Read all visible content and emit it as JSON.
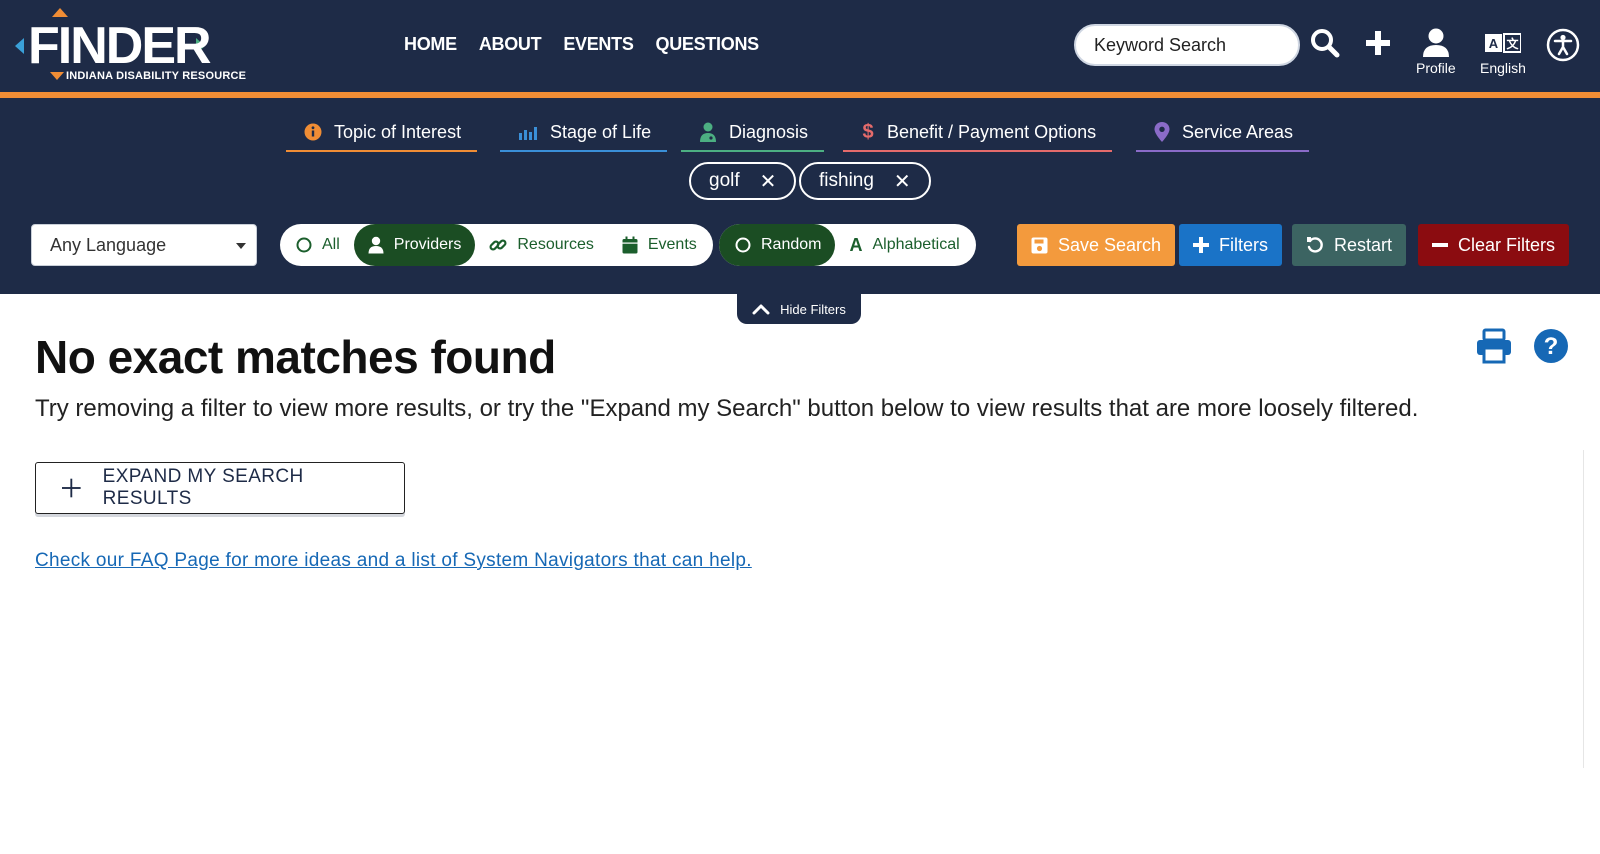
{
  "brand": {
    "name": "FINDER",
    "tagline": "INDIANA DISABILITY RESOURCE"
  },
  "nav": {
    "items": [
      "HOME",
      "ABOUT",
      "EVENTS",
      "QUESTIONS"
    ]
  },
  "search": {
    "placeholder": "Keyword Search"
  },
  "header_actions": {
    "profile_label": "Profile",
    "language_label": "English"
  },
  "categories": [
    {
      "label": "Topic of Interest",
      "icon": "info-circle-icon",
      "color": "#f08d35"
    },
    {
      "label": "Stage of Life",
      "icon": "bar-chart-icon",
      "color": "#3a8fd8"
    },
    {
      "label": "Diagnosis",
      "icon": "doctor-icon",
      "color": "#4caf82"
    },
    {
      "label": "Benefit / Payment Options",
      "icon": "dollar-icon",
      "color": "#e56b6b"
    },
    {
      "label": "Service Areas",
      "icon": "map-pin-icon",
      "color": "#8a6bc8"
    }
  ],
  "chips": [
    {
      "label": "golf"
    },
    {
      "label": "fishing"
    }
  ],
  "language_select": {
    "value": "Any Language"
  },
  "type_filter": {
    "items": [
      {
        "label": "All",
        "icon": "circle-icon",
        "active": false
      },
      {
        "label": "Providers",
        "icon": "user-icon",
        "active": true
      },
      {
        "label": "Resources",
        "icon": "link-icon",
        "active": false
      },
      {
        "label": "Events",
        "icon": "calendar-icon",
        "active": false
      }
    ]
  },
  "sort_filter": {
    "items": [
      {
        "label": "Random",
        "icon": "circle-icon",
        "active": true
      },
      {
        "label": "Alphabetical",
        "icon": "letter-a-icon",
        "active": false
      }
    ]
  },
  "actions": {
    "save_search": "Save Search",
    "filters": "Filters",
    "restart": "Restart",
    "clear_filters": "Clear Filters",
    "colors": {
      "save_search": "#f39a3d",
      "filters": "#1a73c7",
      "restart": "#3c6462",
      "clear_filters": "#8b0c10"
    }
  },
  "hide_filters": {
    "label": "Hide Filters"
  },
  "results": {
    "title": "No exact matches found",
    "description": "Try removing a filter to view more results, or try the \"Expand my Search\" button below to view results that are more loosely filtered.",
    "expand_button": "EXPAND MY SEARCH RESULTS",
    "faq_link": "Check our FAQ Page for more ideas and a list of System Navigators that can help."
  },
  "theme": {
    "navy": "#1e2b47",
    "orange": "#f08d35",
    "green_dark": "#1b4d23",
    "link_blue": "#1668b5"
  }
}
